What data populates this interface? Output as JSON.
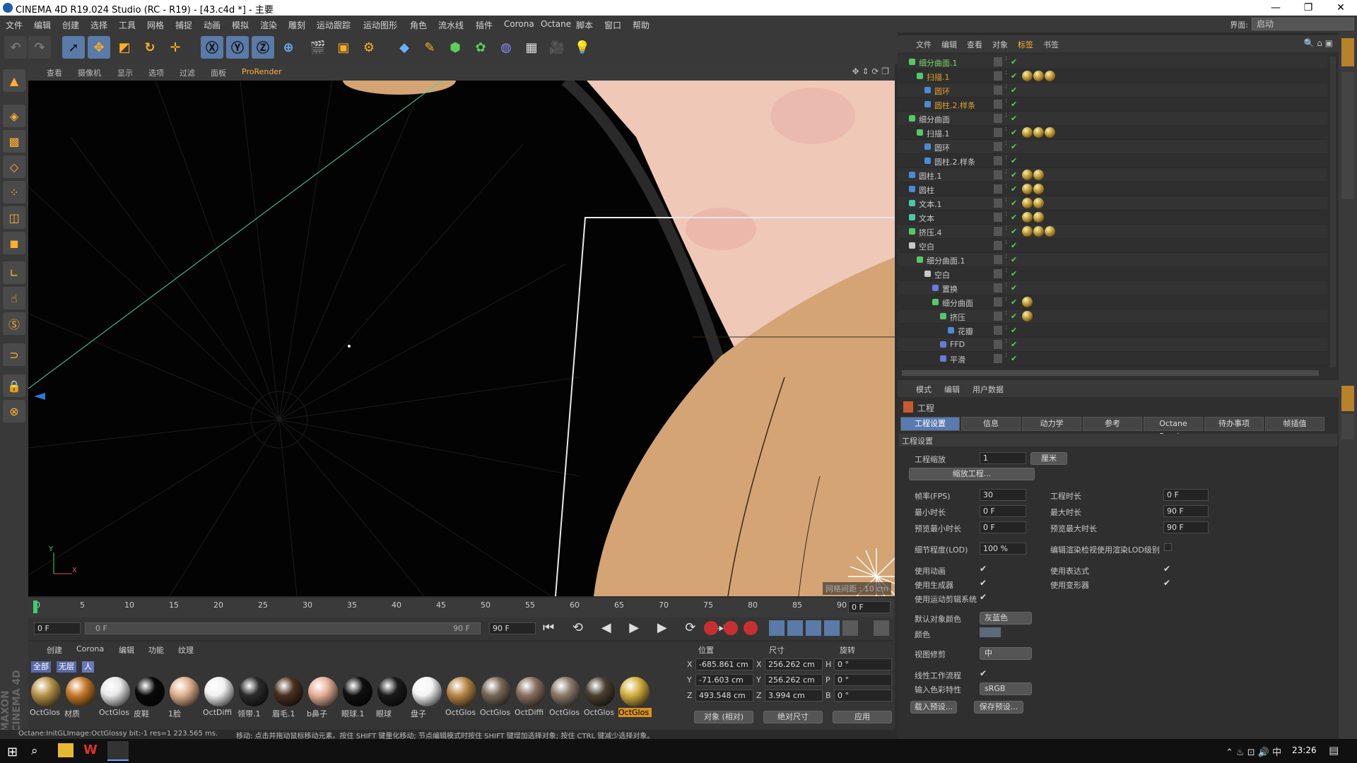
{
  "window": {
    "title": "CINEMA 4D R19.024 Studio (RC - R19) - [43.c4d *] - 主要",
    "min": "—",
    "max": "❐",
    "close": "✕"
  },
  "menu": [
    "文件",
    "编辑",
    "创建",
    "选择",
    "工具",
    "网格",
    "捕捉",
    "动画",
    "模拟",
    "渲染",
    "雕刻",
    "运动跟踪",
    "运动图形",
    "角色",
    "流水线",
    "插件",
    "Corona",
    "Octane",
    "脚本",
    "窗口",
    "帮助"
  ],
  "interface": {
    "label": "界面:",
    "value": "启动"
  },
  "viewport": {
    "menu": [
      "查看",
      "摄像机",
      "显示",
      "选项",
      "过滤",
      "面板",
      "ProRender"
    ],
    "grid_label": "网格间距 : 10 cm",
    "axis_y": "Y",
    "axis_x": "X"
  },
  "timeline": {
    "ticks": [
      "0",
      "5",
      "10",
      "15",
      "20",
      "25",
      "30",
      "35",
      "40",
      "45",
      "50",
      "55",
      "60",
      "65",
      "70",
      "75",
      "80",
      "85",
      "90"
    ],
    "frame_field": "0 F"
  },
  "timectrl": {
    "start": "0 F",
    "range_start": "0 F",
    "range_end": "90 F",
    "end": "90 F"
  },
  "materials": {
    "menu": [
      "创建",
      "Corona",
      "编辑",
      "功能",
      "纹理"
    ],
    "filters": [
      "全部",
      "无层",
      "人"
    ],
    "items": [
      {
        "name": "OctGlos",
        "color": "#b8954a"
      },
      {
        "name": "材质",
        "color": "#c87a2a"
      },
      {
        "name": "OctGlos",
        "color": "#e8e8e8"
      },
      {
        "name": "皮鞋",
        "color": "#0a0a0a"
      },
      {
        "name": "1脸",
        "color": "#e0b090"
      },
      {
        "name": "OctDiffi",
        "color": "#f0f0f0"
      },
      {
        "name": "领带.1",
        "color": "#2a2a2a"
      },
      {
        "name": "眉毛.1",
        "color": "#4a3020"
      },
      {
        "name": "b鼻子",
        "color": "#e8b098"
      },
      {
        "name": "眼球.1",
        "color": "#101010"
      },
      {
        "name": "眼球",
        "color": "#1a1a1a"
      },
      {
        "name": "盘子",
        "color": "#f4f4f4"
      },
      {
        "name": "OctGlos",
        "color": "#b88848"
      },
      {
        "name": "OctGlos",
        "color": "#786858"
      },
      {
        "name": "OctDiffi",
        "color": "#8a7060"
      },
      {
        "name": "OctGlos",
        "color": "#8a7a6a"
      },
      {
        "name": "OctGlos",
        "color": "#4a4030"
      },
      {
        "name": "OctGlos",
        "color": "#d4b040"
      }
    ]
  },
  "coords": {
    "headers": [
      "位置",
      "尺寸",
      "旋转"
    ],
    "rows": [
      {
        "a": "X",
        "p": "-685.861 cm",
        "b": "X",
        "s": "256.262 cm",
        "c": "H",
        "r": "0 °"
      },
      {
        "a": "Y",
        "p": "-71.603 cm",
        "b": "Y",
        "s": "256.262 cm",
        "c": "P",
        "r": "0 °"
      },
      {
        "a": "Z",
        "p": "493.548 cm",
        "b": "Z",
        "s": "3.994 cm",
        "c": "B",
        "r": "0 °"
      }
    ],
    "mode1": "对象 (相对)",
    "mode2": "绝对尺寸",
    "apply": "应用"
  },
  "status": {
    "left": "Octane:InitGLImage:OctGlossy  bit:-1 res=1  223.565 ms.",
    "right": "移动: 点击并拖动鼠标移动元素。按住 SHIFT 键量化移动; 节点编辑模式时按住 SHIFT 键增加选择对象; 按住 CTRL 键减少选择对象。"
  },
  "objmgr": {
    "menu": [
      "文件",
      "编辑",
      "查看",
      "对象",
      "标签",
      "书签"
    ],
    "objects": [
      {
        "name": "细分曲面.1",
        "indent": 0,
        "color": "#7fd46a",
        "icon": "#55c86a",
        "tags": 0
      },
      {
        "name": "扫描.1",
        "indent": 1,
        "color": "#e0a030",
        "icon": "#55c86a",
        "tags": 3
      },
      {
        "name": "圆环",
        "indent": 2,
        "color": "#e0a030",
        "icon": "#4a8ad8",
        "tags": 0
      },
      {
        "name": "圆柱.2.样条",
        "indent": 2,
        "color": "#e0a030",
        "icon": "#4a8ad8",
        "tags": 0
      },
      {
        "name": "细分曲面",
        "indent": 0,
        "color": "#c8c8c8",
        "icon": "#55c86a",
        "tags": 0
      },
      {
        "name": "扫描.1",
        "indent": 1,
        "color": "#c8c8c8",
        "icon": "#55c86a",
        "tags": 3
      },
      {
        "name": "圆环",
        "indent": 2,
        "color": "#c8c8c8",
        "icon": "#4a8ad8",
        "tags": 0
      },
      {
        "name": "圆柱.2.样条",
        "indent": 2,
        "color": "#c8c8c8",
        "icon": "#4a8ad8",
        "tags": 0
      },
      {
        "name": "圆柱.1",
        "indent": 0,
        "color": "#c8c8c8",
        "icon": "#4a8ad8",
        "tags": 2
      },
      {
        "name": "圆柱",
        "indent": 0,
        "color": "#c8c8c8",
        "icon": "#4a8ad8",
        "tags": 2
      },
      {
        "name": "文本.1",
        "indent": 0,
        "color": "#c8c8c8",
        "icon": "#4ac8a8",
        "tags": 2
      },
      {
        "name": "文本",
        "indent": 0,
        "color": "#c8c8c8",
        "icon": "#4ac8a8",
        "tags": 2
      },
      {
        "name": "挤压.4",
        "indent": 0,
        "color": "#c8c8c8",
        "icon": "#55c86a",
        "tags": 3
      },
      {
        "name": "空白",
        "indent": 0,
        "color": "#c8c8c8",
        "icon": "#c8c8c8",
        "tags": 0
      },
      {
        "name": "细分曲面.1",
        "indent": 1,
        "color": "#c8c8c8",
        "icon": "#55c86a",
        "tags": 0
      },
      {
        "name": "空白",
        "indent": 2,
        "color": "#c8c8c8",
        "icon": "#c8c8c8",
        "tags": 0
      },
      {
        "name": "置换",
        "indent": 3,
        "color": "#c8c8c8",
        "icon": "#6a7ad8",
        "tags": 0
      },
      {
        "name": "细分曲面",
        "indent": 3,
        "color": "#c8c8c8",
        "icon": "#55c86a",
        "tags": 1
      },
      {
        "name": "挤压",
        "indent": 4,
        "color": "#c8c8c8",
        "icon": "#55c86a",
        "tags": 1
      },
      {
        "name": "花瓣",
        "indent": 5,
        "color": "#c8c8c8",
        "icon": "#4a8ad8",
        "tags": 0
      },
      {
        "name": "FFD",
        "indent": 4,
        "color": "#c8c8c8",
        "icon": "#6a7ad8",
        "tags": 0
      },
      {
        "name": "平滑",
        "indent": 4,
        "color": "#c8c8c8",
        "icon": "#6a7ad8",
        "tags": 0
      }
    ]
  },
  "attr": {
    "menu": [
      "模式",
      "编辑",
      "用户数据"
    ],
    "title": "工程",
    "tabs": [
      "工程设置",
      "信息",
      "动力学",
      "参考",
      "Octane Render",
      "待办事项",
      "帧插值"
    ],
    "section": "工程设置",
    "scale_label": "工程缩放",
    "scale_val": "1",
    "scale_unit": "厘米",
    "scale_btn": "缩放工程...",
    "fps_label": "帧率(FPS)",
    "fps": "30",
    "mintime_label": "最小时长",
    "mintime": "0 F",
    "pvmin_label": "预览最小时长",
    "pvmin": "0 F",
    "len_label": "工程时长",
    "len": "0 F",
    "maxtime_label": "最大时长",
    "maxtime": "90 F",
    "pvmax_label": "预览最大时长",
    "pvmax": "90 F",
    "lod_label": "细节程度(LOD)",
    "lod": "100 %",
    "lod_r": "编辑渲染检视使用渲染LOD级别",
    "anim": "使用动画",
    "gen": "使用生成器",
    "mograph": "使用运动剪辑系统",
    "expr": "使用表达式",
    "deform": "使用变形器",
    "defcolor_label": "默认对象颜色",
    "defcolor": "灰蓝色",
    "color_label": "颜色",
    "clip_label": "视图修剪",
    "clip": "中",
    "linear": "线性工作流程",
    "input_label": "输入色彩特性",
    "input": "sRGB",
    "load": "载入预设...",
    "save": "保存预设..."
  },
  "taskbar": {
    "time": "23:26"
  }
}
